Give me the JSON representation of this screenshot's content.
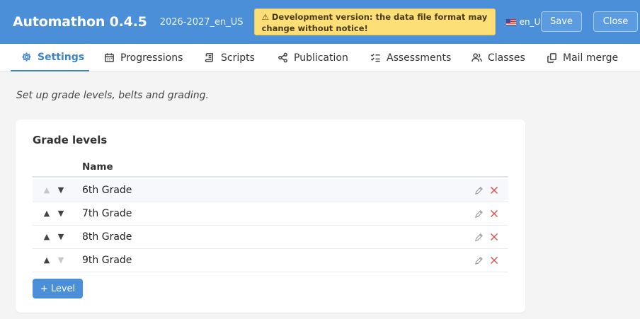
{
  "header": {
    "app_title": "Automathon 0.4.5",
    "year_label": "2026-2027_en_US",
    "warning": "⚠ Development version: the data file format may change without notice!",
    "locale_label": "en_US",
    "save_label": "Save",
    "close_label": "Close"
  },
  "tabs": [
    {
      "label": "Settings",
      "icon": "gear-icon",
      "active": true
    },
    {
      "label": "Progressions",
      "icon": "calendar-icon",
      "active": false
    },
    {
      "label": "Scripts",
      "icon": "scroll-icon",
      "active": false
    },
    {
      "label": "Publication",
      "icon": "share-icon",
      "active": false
    },
    {
      "label": "Assessments",
      "icon": "checklist-icon",
      "active": false
    },
    {
      "label": "Classes",
      "icon": "users-icon",
      "active": false
    },
    {
      "label": "Mail merge",
      "icon": "copy-icon",
      "active": false
    }
  ],
  "main": {
    "subtitle": "Set up grade levels, belts and grading.",
    "grade_levels": {
      "title": "Grade levels",
      "column_name": "Name",
      "rows": [
        {
          "name": "6th Grade",
          "up_enabled": false,
          "down_enabled": true
        },
        {
          "name": "7th Grade",
          "up_enabled": true,
          "down_enabled": true
        },
        {
          "name": "8th Grade",
          "up_enabled": true,
          "down_enabled": true
        },
        {
          "name": "9th Grade",
          "up_enabled": true,
          "down_enabled": false
        }
      ],
      "add_label": "+ Level",
      "arrow_up": "▲",
      "arrow_down": "▼"
    }
  },
  "colors": {
    "accent": "#4a8fd8",
    "warning_bg": "#fddf78",
    "delete": "#d9534f"
  }
}
